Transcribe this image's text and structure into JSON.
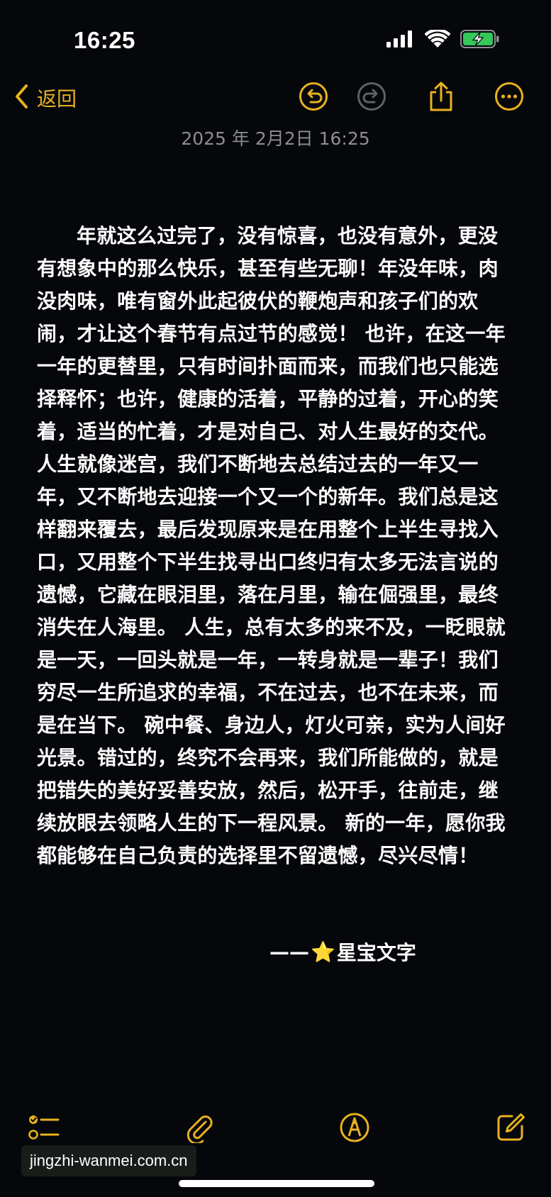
{
  "status_bar": {
    "time": "16:25",
    "battery_charging": true
  },
  "nav": {
    "back_label": "返回",
    "accent_color": "#e8b21c"
  },
  "note": {
    "date": "2025 年 2月2日 16:25",
    "body": "年就这么过完了，没有惊喜，也没有意外，更没有想象中的那么快乐，甚至有些无聊！年没年味，肉没肉味，唯有窗外此起彼伏的鞭炮声和孩子们的欢闹，才让这个春节有点过节的感觉！ 也许，在这一年一年的更替里，只有时间扑面而来，而我们也只能选择释怀；也许，健康的活着，平静的过着，开心的笑着，适当的忙着，才是对自己、对人生最好的交代。 人生就像迷宫，我们不断地去总结过去的一年又一年，又不断地去迎接一个又一个的新年。我们总是这样翻来覆去，最后发现原来是在用整个上半生寻找入口，又用整个下半生找寻出口终归有太多无法言说的遗憾，它藏在眼泪里，落在月里，输在倔强里，最终消失在人海里。 人生，总有太多的来不及，一眨眼就是一天，一回头就是一年，一转身就是一辈子！我们穷尽一生所追求的幸福，不在过去，也不在未来，而是在当下。 碗中餐、身边人，灯火可亲，实为人间好光景。错过的，终究不会再来，我们所能做的，就是把错失的美好妥善安放，然后，松开手，往前走，继续放眼去领略人生的下一程风景。 新的一年，愿你我都能够在自己负责的选择里不留遗憾，尽兴尽情！",
    "signature_dash": "——",
    "signature_star": "⭐",
    "signature_name": "星宝文字"
  },
  "watermark": {
    "text": "jingzhi-wanmei.com.cn"
  },
  "icons": {
    "undo": "undo-icon",
    "redo": "redo-icon",
    "share": "share-icon",
    "more": "more-icon",
    "checklist": "checklist-icon",
    "attachment": "paperclip-icon",
    "markup": "markup-pen-icon",
    "compose": "compose-icon"
  }
}
